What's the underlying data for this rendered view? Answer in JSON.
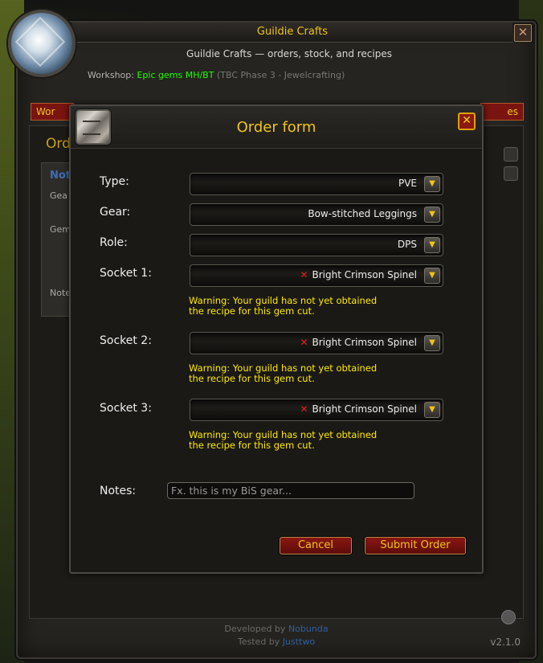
{
  "window": {
    "title": "Guildie Crafts",
    "subtitle": "Guildie Crafts — orders, stock, and recipes",
    "workshop_label": "Workshop:",
    "workshop_name": "Epic gems MH/BT",
    "workshop_detail": "(TBC Phase 3 - Jewelcrafting)",
    "close": "✕"
  },
  "background": {
    "tab_left": "Wor",
    "tab_right": "es",
    "heading": "Ord",
    "card_nav": "Not",
    "card_labels": [
      "Gea",
      "Gem",
      "Note"
    ]
  },
  "footer": {
    "developed_by": "Developed by",
    "developer": "Nobunda",
    "tested_by": "Tested by",
    "tester": "Justtwo",
    "version": "v2.1.0"
  },
  "dialog": {
    "title": "Order form",
    "close": "✕",
    "fields": {
      "type": {
        "label": "Type:",
        "value": "PVE"
      },
      "gear": {
        "label": "Gear:",
        "value": "Bow-stitched Leggings"
      },
      "role": {
        "label": "Role:",
        "value": "DPS"
      },
      "socket1": {
        "label": "Socket 1:",
        "value": "Bright Crimson Spinel",
        "status": "✕"
      },
      "socket2": {
        "label": "Socket 2:",
        "value": "Bright Crimson Spinel",
        "status": "✕"
      },
      "socket3": {
        "label": "Socket 3:",
        "value": "Bright Crimson Spinel",
        "status": "✕"
      }
    },
    "warning_line1": "Warning: Your guild has not yet obtained",
    "warning_line2": "the recipe for this gem cut.",
    "notes": {
      "label": "Notes:",
      "placeholder": "Fx. this is my BiS gear..."
    },
    "buttons": {
      "cancel": "Cancel",
      "submit": "Submit Order"
    },
    "dropdown_arrow": "▼"
  },
  "colors": {
    "title_gold": "#f1c318",
    "warning_yellow": "#ffea00",
    "workshop_green": "#1eff00",
    "button_red": "#7a1410",
    "error_x": "#e02020"
  },
  "icons": {
    "portrait": "diamond-gem-icon",
    "dialog": "crate-icon",
    "dropdown": "chevron-down-icon",
    "socket_status": "red-x-icon"
  }
}
